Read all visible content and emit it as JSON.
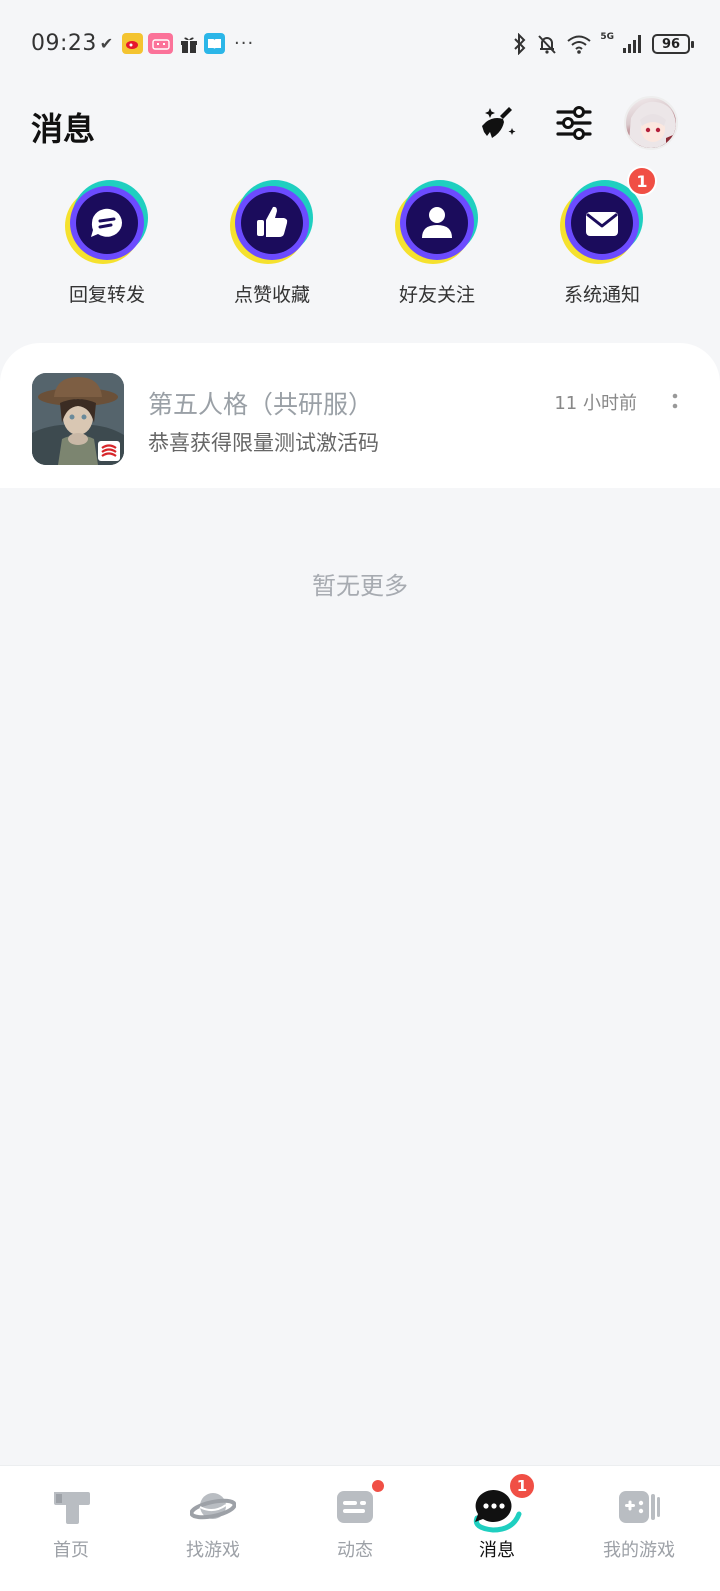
{
  "status_bar": {
    "time": "09:23",
    "net_type": "5G",
    "battery": "96",
    "notif_icons": [
      "tapd-icon",
      "weibo-icon",
      "bilibili-icon",
      "gift-icon",
      "book-icon"
    ],
    "more": "···"
  },
  "header": {
    "title": "消息",
    "actions": [
      "clear-unread-icon",
      "filter-settings-icon",
      "avatar"
    ]
  },
  "categories": [
    {
      "label": "回复转发",
      "icon": "reply-bubble-icon",
      "badge": ""
    },
    {
      "label": "点赞收藏",
      "icon": "thumb-up-icon",
      "badge": ""
    },
    {
      "label": "好友关注",
      "icon": "person-icon",
      "badge": ""
    },
    {
      "label": "系统通知",
      "icon": "envelope-icon",
      "badge": "1"
    }
  ],
  "messages": [
    {
      "title": "第五人格（共研服）",
      "subtitle": "恭喜获得限量测试激活码",
      "time": "11 小时前",
      "thumb": "identity-v-game-thumbnail"
    }
  ],
  "empty_hint": "暂无更多",
  "tabbar": {
    "tabs": [
      {
        "label": "首页",
        "icon": "home-t-icon",
        "active": false
      },
      {
        "label": "找游戏",
        "icon": "planet-icon",
        "active": false
      },
      {
        "label": "动态",
        "icon": "feed-icon",
        "active": false,
        "dot": true
      },
      {
        "label": "消息",
        "icon": "chat-icon",
        "active": true,
        "badge": "1"
      },
      {
        "label": "我的游戏",
        "icon": "gamepad-icon",
        "active": false
      }
    ]
  },
  "colors": {
    "accent_teal": "#1fcfc0",
    "accent_yellow": "#f5e12e",
    "accent_purple": "#6c4bff",
    "circle_navy": "#1b0c5c",
    "badge_red": "#f04f45"
  }
}
